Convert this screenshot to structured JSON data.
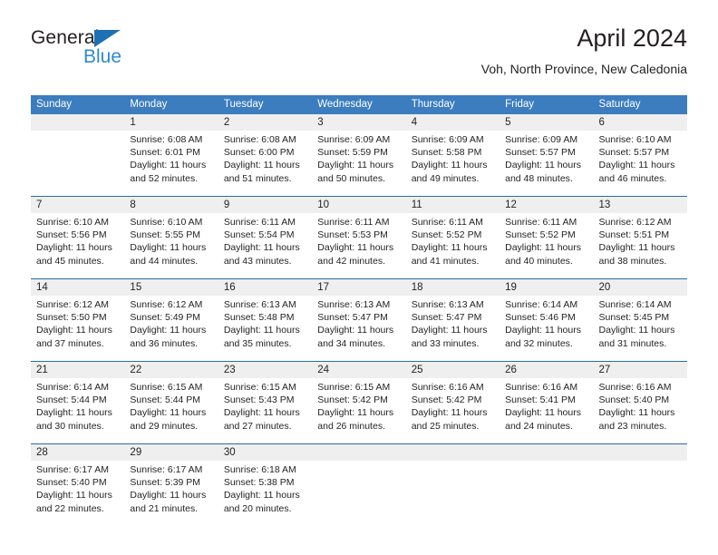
{
  "brand": {
    "name_top": "General",
    "name_bottom": "Blue",
    "triangle_color": "#1f6fb5",
    "blue_color": "#2e8ad0"
  },
  "header": {
    "title": "April 2024",
    "subtitle": "Voh, North Province, New Caledonia"
  },
  "theme": {
    "header_row_bg": "#3b7dbf",
    "header_row_text": "#ffffff",
    "row_divider": "#2b6ca8",
    "daynum_bg": "#efefef",
    "text": "#231f20"
  },
  "calendar": {
    "weekdays": [
      "Sunday",
      "Monday",
      "Tuesday",
      "Wednesday",
      "Thursday",
      "Friday",
      "Saturday"
    ],
    "weeks": [
      [
        {
          "day": "",
          "sunrise": "",
          "sunset": "",
          "daylight_line1": "",
          "daylight_line2": ""
        },
        {
          "day": "1",
          "sunrise": "Sunrise: 6:08 AM",
          "sunset": "Sunset: 6:01 PM",
          "daylight_line1": "Daylight: 11 hours",
          "daylight_line2": "and 52 minutes."
        },
        {
          "day": "2",
          "sunrise": "Sunrise: 6:08 AM",
          "sunset": "Sunset: 6:00 PM",
          "daylight_line1": "Daylight: 11 hours",
          "daylight_line2": "and 51 minutes."
        },
        {
          "day": "3",
          "sunrise": "Sunrise: 6:09 AM",
          "sunset": "Sunset: 5:59 PM",
          "daylight_line1": "Daylight: 11 hours",
          "daylight_line2": "and 50 minutes."
        },
        {
          "day": "4",
          "sunrise": "Sunrise: 6:09 AM",
          "sunset": "Sunset: 5:58 PM",
          "daylight_line1": "Daylight: 11 hours",
          "daylight_line2": "and 49 minutes."
        },
        {
          "day": "5",
          "sunrise": "Sunrise: 6:09 AM",
          "sunset": "Sunset: 5:57 PM",
          "daylight_line1": "Daylight: 11 hours",
          "daylight_line2": "and 48 minutes."
        },
        {
          "day": "6",
          "sunrise": "Sunrise: 6:10 AM",
          "sunset": "Sunset: 5:57 PM",
          "daylight_line1": "Daylight: 11 hours",
          "daylight_line2": "and 46 minutes."
        }
      ],
      [
        {
          "day": "7",
          "sunrise": "Sunrise: 6:10 AM",
          "sunset": "Sunset: 5:56 PM",
          "daylight_line1": "Daylight: 11 hours",
          "daylight_line2": "and 45 minutes."
        },
        {
          "day": "8",
          "sunrise": "Sunrise: 6:10 AM",
          "sunset": "Sunset: 5:55 PM",
          "daylight_line1": "Daylight: 11 hours",
          "daylight_line2": "and 44 minutes."
        },
        {
          "day": "9",
          "sunrise": "Sunrise: 6:11 AM",
          "sunset": "Sunset: 5:54 PM",
          "daylight_line1": "Daylight: 11 hours",
          "daylight_line2": "and 43 minutes."
        },
        {
          "day": "10",
          "sunrise": "Sunrise: 6:11 AM",
          "sunset": "Sunset: 5:53 PM",
          "daylight_line1": "Daylight: 11 hours",
          "daylight_line2": "and 42 minutes."
        },
        {
          "day": "11",
          "sunrise": "Sunrise: 6:11 AM",
          "sunset": "Sunset: 5:52 PM",
          "daylight_line1": "Daylight: 11 hours",
          "daylight_line2": "and 41 minutes."
        },
        {
          "day": "12",
          "sunrise": "Sunrise: 6:11 AM",
          "sunset": "Sunset: 5:52 PM",
          "daylight_line1": "Daylight: 11 hours",
          "daylight_line2": "and 40 minutes."
        },
        {
          "day": "13",
          "sunrise": "Sunrise: 6:12 AM",
          "sunset": "Sunset: 5:51 PM",
          "daylight_line1": "Daylight: 11 hours",
          "daylight_line2": "and 38 minutes."
        }
      ],
      [
        {
          "day": "14",
          "sunrise": "Sunrise: 6:12 AM",
          "sunset": "Sunset: 5:50 PM",
          "daylight_line1": "Daylight: 11 hours",
          "daylight_line2": "and 37 minutes."
        },
        {
          "day": "15",
          "sunrise": "Sunrise: 6:12 AM",
          "sunset": "Sunset: 5:49 PM",
          "daylight_line1": "Daylight: 11 hours",
          "daylight_line2": "and 36 minutes."
        },
        {
          "day": "16",
          "sunrise": "Sunrise: 6:13 AM",
          "sunset": "Sunset: 5:48 PM",
          "daylight_line1": "Daylight: 11 hours",
          "daylight_line2": "and 35 minutes."
        },
        {
          "day": "17",
          "sunrise": "Sunrise: 6:13 AM",
          "sunset": "Sunset: 5:47 PM",
          "daylight_line1": "Daylight: 11 hours",
          "daylight_line2": "and 34 minutes."
        },
        {
          "day": "18",
          "sunrise": "Sunrise: 6:13 AM",
          "sunset": "Sunset: 5:47 PM",
          "daylight_line1": "Daylight: 11 hours",
          "daylight_line2": "and 33 minutes."
        },
        {
          "day": "19",
          "sunrise": "Sunrise: 6:14 AM",
          "sunset": "Sunset: 5:46 PM",
          "daylight_line1": "Daylight: 11 hours",
          "daylight_line2": "and 32 minutes."
        },
        {
          "day": "20",
          "sunrise": "Sunrise: 6:14 AM",
          "sunset": "Sunset: 5:45 PM",
          "daylight_line1": "Daylight: 11 hours",
          "daylight_line2": "and 31 minutes."
        }
      ],
      [
        {
          "day": "21",
          "sunrise": "Sunrise: 6:14 AM",
          "sunset": "Sunset: 5:44 PM",
          "daylight_line1": "Daylight: 11 hours",
          "daylight_line2": "and 30 minutes."
        },
        {
          "day": "22",
          "sunrise": "Sunrise: 6:15 AM",
          "sunset": "Sunset: 5:44 PM",
          "daylight_line1": "Daylight: 11 hours",
          "daylight_line2": "and 29 minutes."
        },
        {
          "day": "23",
          "sunrise": "Sunrise: 6:15 AM",
          "sunset": "Sunset: 5:43 PM",
          "daylight_line1": "Daylight: 11 hours",
          "daylight_line2": "and 27 minutes."
        },
        {
          "day": "24",
          "sunrise": "Sunrise: 6:15 AM",
          "sunset": "Sunset: 5:42 PM",
          "daylight_line1": "Daylight: 11 hours",
          "daylight_line2": "and 26 minutes."
        },
        {
          "day": "25",
          "sunrise": "Sunrise: 6:16 AM",
          "sunset": "Sunset: 5:42 PM",
          "daylight_line1": "Daylight: 11 hours",
          "daylight_line2": "and 25 minutes."
        },
        {
          "day": "26",
          "sunrise": "Sunrise: 6:16 AM",
          "sunset": "Sunset: 5:41 PM",
          "daylight_line1": "Daylight: 11 hours",
          "daylight_line2": "and 24 minutes."
        },
        {
          "day": "27",
          "sunrise": "Sunrise: 6:16 AM",
          "sunset": "Sunset: 5:40 PM",
          "daylight_line1": "Daylight: 11 hours",
          "daylight_line2": "and 23 minutes."
        }
      ],
      [
        {
          "day": "28",
          "sunrise": "Sunrise: 6:17 AM",
          "sunset": "Sunset: 5:40 PM",
          "daylight_line1": "Daylight: 11 hours",
          "daylight_line2": "and 22 minutes."
        },
        {
          "day": "29",
          "sunrise": "Sunrise: 6:17 AM",
          "sunset": "Sunset: 5:39 PM",
          "daylight_line1": "Daylight: 11 hours",
          "daylight_line2": "and 21 minutes."
        },
        {
          "day": "30",
          "sunrise": "Sunrise: 6:18 AM",
          "sunset": "Sunset: 5:38 PM",
          "daylight_line1": "Daylight: 11 hours",
          "daylight_line2": "and 20 minutes."
        },
        {
          "day": "",
          "sunrise": "",
          "sunset": "",
          "daylight_line1": "",
          "daylight_line2": ""
        },
        {
          "day": "",
          "sunrise": "",
          "sunset": "",
          "daylight_line1": "",
          "daylight_line2": ""
        },
        {
          "day": "",
          "sunrise": "",
          "sunset": "",
          "daylight_line1": "",
          "daylight_line2": ""
        },
        {
          "day": "",
          "sunrise": "",
          "sunset": "",
          "daylight_line1": "",
          "daylight_line2": ""
        }
      ]
    ]
  }
}
